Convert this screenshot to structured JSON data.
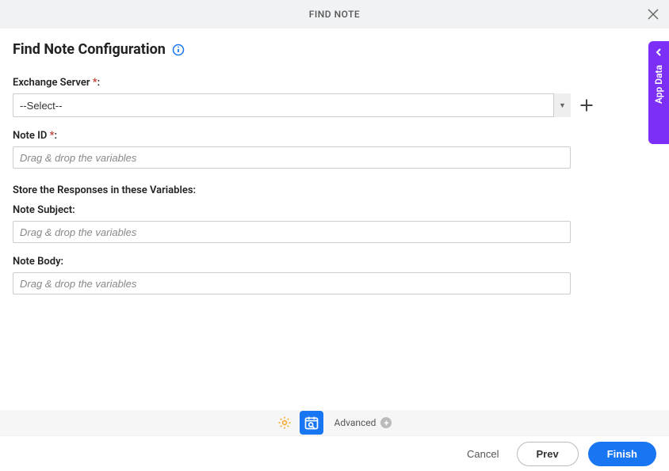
{
  "header": {
    "title": "FIND NOTE"
  },
  "main": {
    "title": "Find Note Configuration"
  },
  "fields": {
    "exchange_server": {
      "label": "Exchange Server ",
      "selected": "--Select--"
    },
    "note_id": {
      "label": "Note ID ",
      "placeholder": "Drag & drop the variables"
    },
    "section": "Store the Responses in these Variables:",
    "note_subject": {
      "label": "Note Subject:",
      "placeholder": "Drag & drop the variables"
    },
    "note_body": {
      "label": "Note Body:",
      "placeholder": "Drag & drop the variables"
    }
  },
  "bottom": {
    "advanced": "Advanced"
  },
  "footer": {
    "cancel": "Cancel",
    "prev": "Prev",
    "finish": "Finish"
  },
  "side": {
    "label": "App Data"
  }
}
